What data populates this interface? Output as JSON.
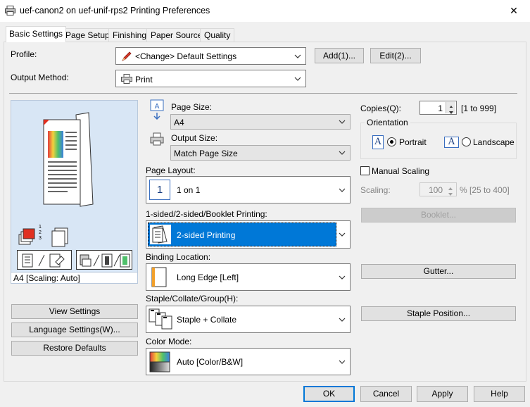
{
  "window": {
    "title": "uef-canon2 on uef-unif-rps2 Printing Preferences",
    "close_glyph": "✕"
  },
  "tabs": [
    {
      "label": "Basic Settings",
      "active": true
    },
    {
      "label": "Page Setup"
    },
    {
      "label": "Finishing"
    },
    {
      "label": "Paper Source"
    },
    {
      "label": "Quality"
    }
  ],
  "profile": {
    "label": "Profile:",
    "value": "<Change> Default Settings",
    "add_button": "Add(1)...",
    "edit_button": "Edit(2)..."
  },
  "output_method": {
    "label": "Output Method:",
    "value": "Print"
  },
  "preview": {
    "caption": "A4 [Scaling: Auto]",
    "collate_marks": [
      "1",
      "2",
      "3"
    ]
  },
  "left_buttons": {
    "view_settings": "View Settings",
    "language_settings": "Language Settings(W)...",
    "restore_defaults": "Restore Defaults"
  },
  "page_size": {
    "label": "Page Size:",
    "value": "A4"
  },
  "output_size": {
    "label": "Output Size:",
    "value": "Match Page Size"
  },
  "page_layout": {
    "label": "Page Layout:",
    "value": "1 on 1",
    "icon_text": "1"
  },
  "duplex": {
    "label": "1-sided/2-sided/Booklet Printing:",
    "value": "2-sided Printing"
  },
  "binding": {
    "label": "Binding Location:",
    "value": "Long Edge [Left]"
  },
  "staple": {
    "label": "Staple/Collate/Group(H):",
    "value": "Staple + Collate"
  },
  "color_mode": {
    "label": "Color Mode:",
    "value": "Auto [Color/B&W]"
  },
  "copies": {
    "label": "Copies(Q):",
    "value": "1",
    "range": "[1 to 999]"
  },
  "orientation": {
    "label": "Orientation",
    "portrait": "Portrait",
    "landscape": "Landscape",
    "icon_letter": "A",
    "selected": "portrait"
  },
  "manual_scaling": {
    "label": "Manual Scaling",
    "checked": false
  },
  "scaling": {
    "label": "Scaling:",
    "value": "100",
    "range": "% [25 to 400]"
  },
  "right_buttons": {
    "booklet": "Booklet...",
    "gutter": "Gutter...",
    "staple_position": "Staple Position..."
  },
  "footer": {
    "ok": "OK",
    "cancel": "Cancel",
    "apply": "Apply",
    "help": "Help"
  },
  "colors": {
    "accent": "#0078d7",
    "panel": "#f0f0f0",
    "preview_bg": "#d8e6f5"
  }
}
